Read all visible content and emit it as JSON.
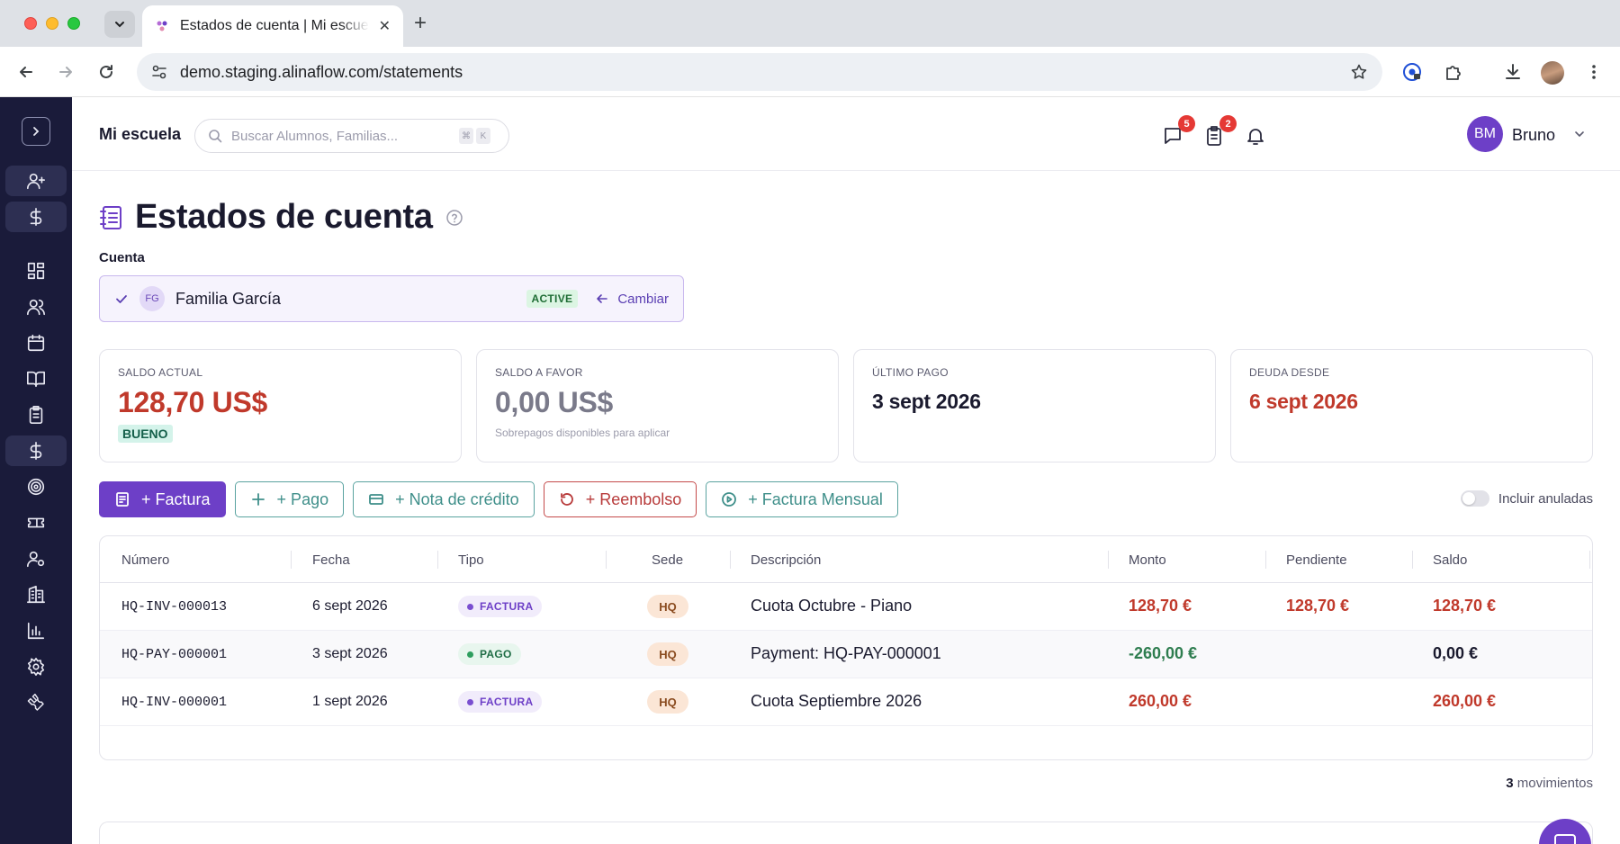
{
  "browser": {
    "tab_title": "Estados de cuenta | Mi escuela",
    "url": "demo.staging.alinaflow.com/statements"
  },
  "header": {
    "school_name": "Mi escuela",
    "search_placeholder": "Buscar Alumnos, Familias...",
    "shortcut_keys": [
      "⌘",
      "K"
    ],
    "messages_badge": "5",
    "tasks_badge": "2",
    "user_initials": "BM",
    "user_name": "Bruno"
  },
  "page": {
    "title": "Estados de cuenta",
    "account_label": "Cuenta",
    "account": {
      "initials": "FG",
      "name": "Familia García",
      "status": "ACTIVE",
      "change_label": "Cambiar"
    }
  },
  "stats": [
    {
      "label": "SALDO ACTUAL",
      "value": "128,70 US$",
      "pill": "BUENO"
    },
    {
      "label": "SALDO A FAVOR",
      "value": "0,00 US$",
      "note": "Sobrepagos disponibles para aplicar"
    },
    {
      "label": "ÚLTIMO PAGO",
      "value": "3 sept 2026"
    },
    {
      "label": "DEUDA DESDE",
      "value": "6 sept 2026"
    }
  ],
  "actions": {
    "invoice": "+ Factura",
    "payment": "+ Pago",
    "credit_note": "+ Nota de crédito",
    "refund": "+ Reembolso",
    "monthly_invoice": "+ Factura Mensual",
    "include_voided": "Incluir anuladas"
  },
  "table": {
    "columns": [
      "Número",
      "Fecha",
      "Tipo",
      "Sede",
      "Descripción",
      "Monto",
      "Pendiente",
      "Saldo"
    ],
    "rows": [
      {
        "numero": "HQ-INV-000013",
        "fecha": "6 sept 2026",
        "tipo": "FACTURA",
        "sede": "HQ",
        "descripcion": "Cuota Octubre - Piano",
        "monto": "128,70 €",
        "pendiente": "128,70 €",
        "saldo": "128,70 €"
      },
      {
        "numero": "HQ-PAY-000001",
        "fecha": "3 sept 2026",
        "tipo": "PAGO",
        "sede": "HQ",
        "descripcion": "Payment: HQ-PAY-000001",
        "monto": "-260,00 €",
        "pendiente": "",
        "saldo": "0,00 €"
      },
      {
        "numero": "HQ-INV-000001",
        "fecha": "1 sept 2026",
        "tipo": "FACTURA",
        "sede": "HQ",
        "descripcion": "Cuota Septiembre 2026",
        "monto": "260,00 €",
        "pendiente": "",
        "saldo": "260,00 €"
      }
    ]
  },
  "footer": {
    "movements_count": "3",
    "movements_label": "movimientos"
  },
  "colors": {
    "brand": "#6d3fc7",
    "sidebar": "#1a1b3a",
    "danger": "#c0392b",
    "success": "#2e7d4f"
  }
}
